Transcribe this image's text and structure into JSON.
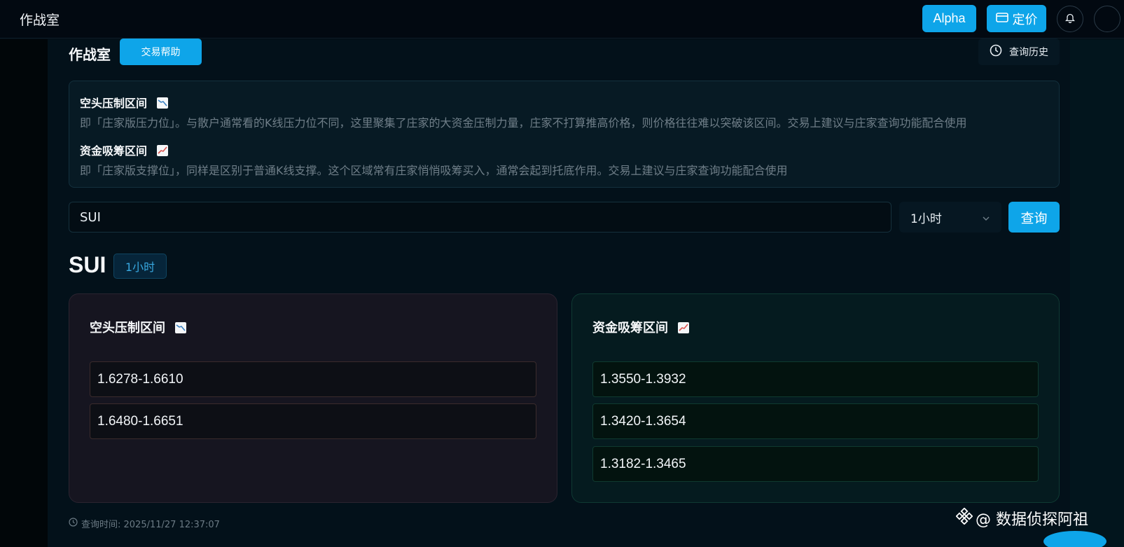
{
  "header": {
    "app_title": "作战室",
    "alpha_label": "Alpha",
    "pricing_label": "定价"
  },
  "toolbar": {
    "section_title": "作战室",
    "help_label": "交易帮助",
    "history_label": "查询历史"
  },
  "info": {
    "short_title": "空头压制区间",
    "short_desc": "即「庄家版压力位」。与散户通常看的K线压力位不同，这里聚集了庄家的大资金压制力量，庄家不打算推高价格，则价格往往难以突破该区间。交易上建议与庄家查询功能配合使用",
    "long_title": "资金吸筹区间",
    "long_desc": "即「庄家版支撑位」，同样是区别于普通K线支撑。这个区域常有庄家悄悄吸筹买入，通常会起到托底作用。交易上建议与庄家查询功能配合使用"
  },
  "search": {
    "value": "SUI",
    "timeframe": "1小时",
    "query_label": "查询"
  },
  "result": {
    "symbol": "SUI",
    "timeframe": "1小时",
    "short_title": "空头压制区间",
    "short_ranges": [
      "1.6278-1.6610",
      "1.6480-1.6651"
    ],
    "long_title": "资金吸筹区间",
    "long_ranges": [
      "1.3550-1.3932",
      "1.3420-1.3654",
      "1.3182-1.3465"
    ]
  },
  "footer": {
    "query_time": "查询时间: 2025/11/27 12:37:07"
  },
  "watermark": {
    "text": "@ 数据侦探阿祖"
  },
  "icons": {
    "pricing": "card-icon",
    "bell": "bell-icon",
    "history": "clock-icon",
    "select": "chevron-down-icon",
    "short": "chart-decreasing-icon",
    "long": "chart-increasing-icon",
    "time": "clock-icon",
    "watermark": "binance-logo-icon"
  },
  "colors": {
    "accent": "#0ea5e9",
    "short_panel": "#161520",
    "long_panel": "#051b1f"
  }
}
